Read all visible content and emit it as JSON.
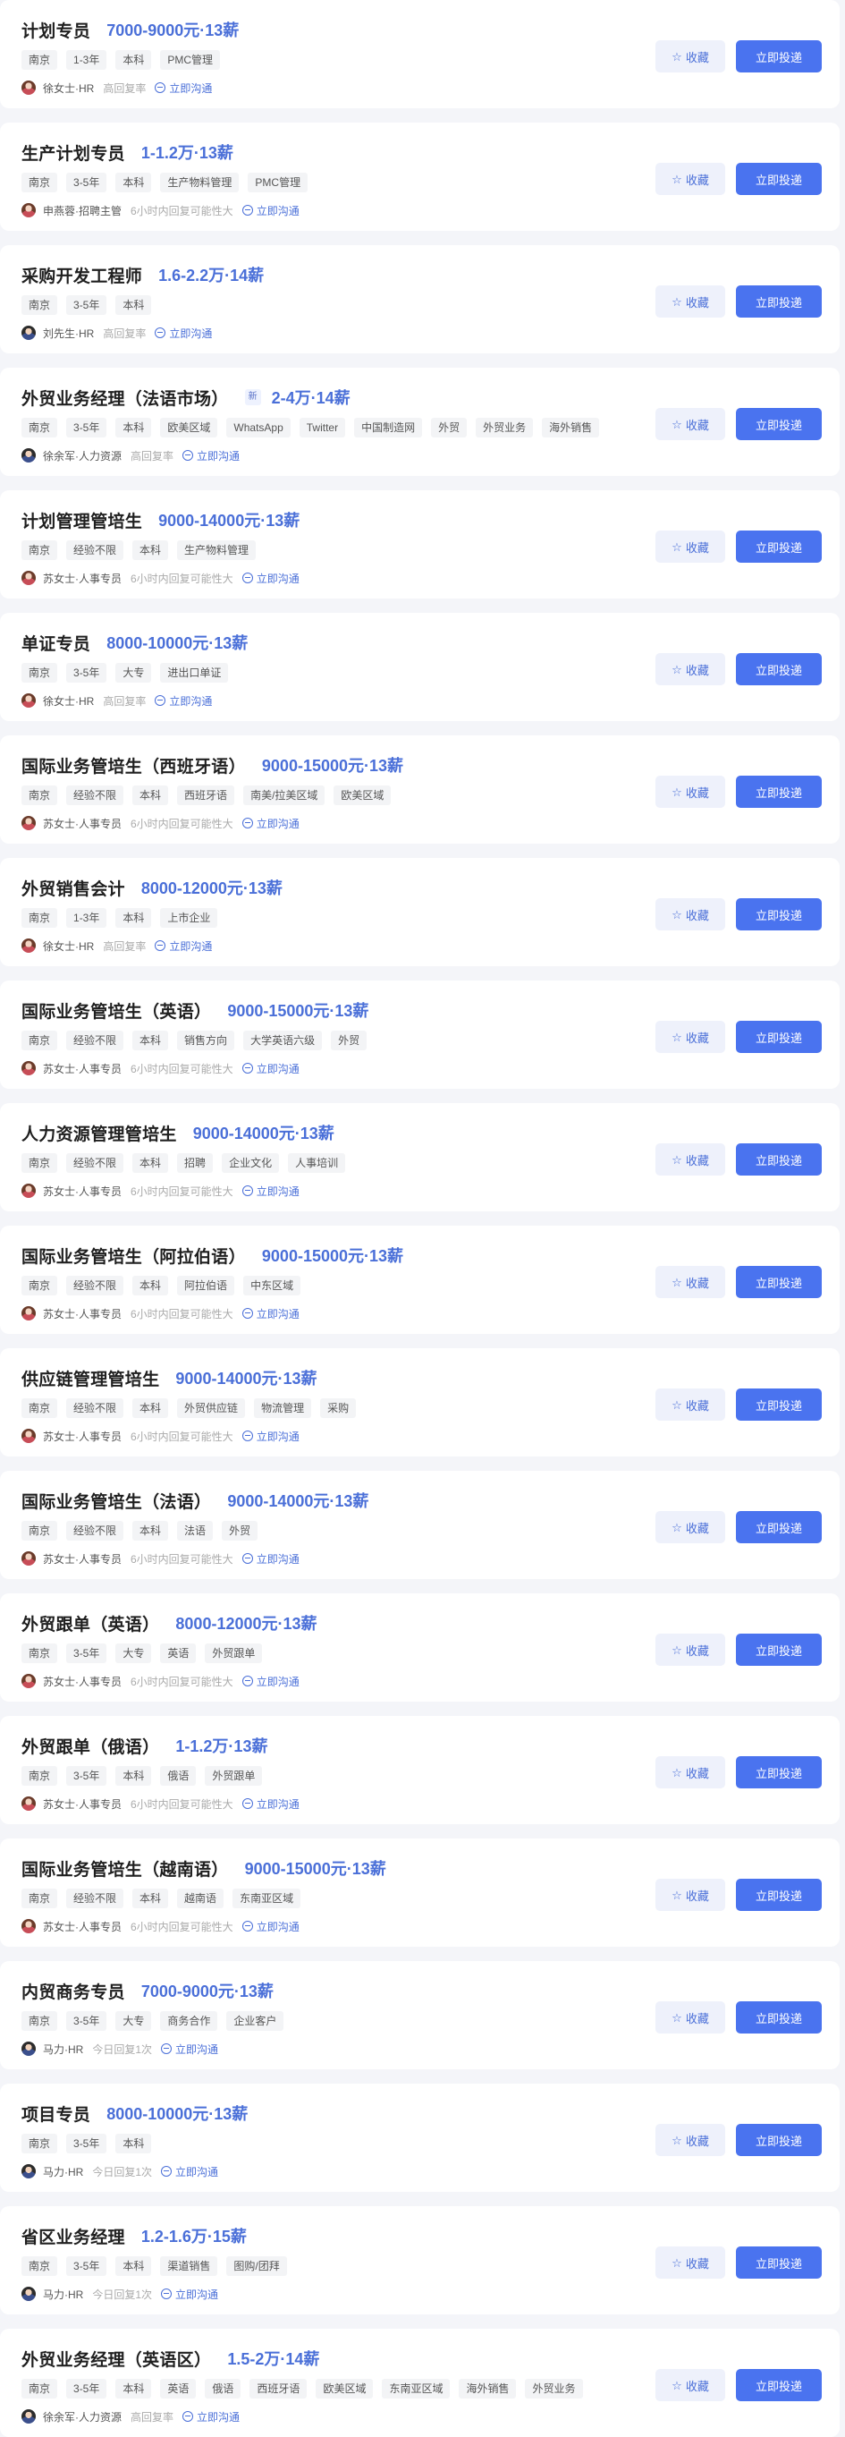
{
  "colors": {
    "accent": "#4a6fd8",
    "apply_button": "#4a73ef",
    "favorite_bg": "#eef1fb",
    "page_bg": "#f4f5f9"
  },
  "actions": {
    "favorite_label": "收藏",
    "apply_label": "立即投递",
    "chat_label": "立即沟通"
  },
  "jobs": [
    {
      "title": "计划专员",
      "badge": "",
      "salary": "7000-9000元·13薪",
      "tags": [
        "南京",
        "1-3年",
        "本科",
        "PMC管理"
      ],
      "recruiter": "徐女士·HR",
      "avatar": "female",
      "reply": "高回复率"
    },
    {
      "title": "生产计划专员",
      "badge": "",
      "salary": "1-1.2万·13薪",
      "tags": [
        "南京",
        "3-5年",
        "本科",
        "生产物料管理",
        "PMC管理"
      ],
      "recruiter": "申燕蓉·招聘主管",
      "avatar": "female",
      "reply": "6小时内回复可能性大"
    },
    {
      "title": "采购开发工程师",
      "badge": "",
      "salary": "1.6-2.2万·14薪",
      "tags": [
        "南京",
        "3-5年",
        "本科"
      ],
      "recruiter": "刘先生·HR",
      "avatar": "male",
      "reply": "高回复率"
    },
    {
      "title": "外贸业务经理（法语市场）",
      "badge": "新",
      "salary": "2-4万·14薪",
      "tags": [
        "南京",
        "3-5年",
        "本科",
        "欧美区域",
        "WhatsApp",
        "Twitter",
        "中国制造网",
        "外贸",
        "外贸业务",
        "海外销售"
      ],
      "recruiter": "徐余军·人力资源",
      "avatar": "male",
      "reply": "高回复率"
    },
    {
      "title": "计划管理管培生",
      "badge": "",
      "salary": "9000-14000元·13薪",
      "tags": [
        "南京",
        "经验不限",
        "本科",
        "生产物料管理"
      ],
      "recruiter": "苏女士·人事专员",
      "avatar": "female",
      "reply": "6小时内回复可能性大"
    },
    {
      "title": "单证专员",
      "badge": "",
      "salary": "8000-10000元·13薪",
      "tags": [
        "南京",
        "3-5年",
        "大专",
        "进出口单证"
      ],
      "recruiter": "徐女士·HR",
      "avatar": "female",
      "reply": "高回复率"
    },
    {
      "title": "国际业务管培生（西班牙语）",
      "badge": "",
      "salary": "9000-15000元·13薪",
      "tags": [
        "南京",
        "经验不限",
        "本科",
        "西班牙语",
        "南美/拉美区域",
        "欧美区域"
      ],
      "recruiter": "苏女士·人事专员",
      "avatar": "female",
      "reply": "6小时内回复可能性大"
    },
    {
      "title": "外贸销售会计",
      "badge": "",
      "salary": "8000-12000元·13薪",
      "tags": [
        "南京",
        "1-3年",
        "本科",
        "上市企业"
      ],
      "recruiter": "徐女士·HR",
      "avatar": "female",
      "reply": "高回复率"
    },
    {
      "title": "国际业务管培生（英语）",
      "badge": "",
      "salary": "9000-15000元·13薪",
      "tags": [
        "南京",
        "经验不限",
        "本科",
        "销售方向",
        "大学英语六级",
        "外贸"
      ],
      "recruiter": "苏女士·人事专员",
      "avatar": "female",
      "reply": "6小时内回复可能性大"
    },
    {
      "title": "人力资源管理管培生",
      "badge": "",
      "salary": "9000-14000元·13薪",
      "tags": [
        "南京",
        "经验不限",
        "本科",
        "招聘",
        "企业文化",
        "人事培训"
      ],
      "recruiter": "苏女士·人事专员",
      "avatar": "female",
      "reply": "6小时内回复可能性大"
    },
    {
      "title": "国际业务管培生（阿拉伯语）",
      "badge": "",
      "salary": "9000-15000元·13薪",
      "tags": [
        "南京",
        "经验不限",
        "本科",
        "阿拉伯语",
        "中东区域"
      ],
      "recruiter": "苏女士·人事专员",
      "avatar": "female",
      "reply": "6小时内回复可能性大"
    },
    {
      "title": "供应链管理管培生",
      "badge": "",
      "salary": "9000-14000元·13薪",
      "tags": [
        "南京",
        "经验不限",
        "本科",
        "外贸供应链",
        "物流管理",
        "采购"
      ],
      "recruiter": "苏女士·人事专员",
      "avatar": "female",
      "reply": "6小时内回复可能性大"
    },
    {
      "title": "国际业务管培生（法语）",
      "badge": "",
      "salary": "9000-14000元·13薪",
      "tags": [
        "南京",
        "经验不限",
        "本科",
        "法语",
        "外贸"
      ],
      "recruiter": "苏女士·人事专员",
      "avatar": "female",
      "reply": "6小时内回复可能性大"
    },
    {
      "title": "外贸跟单（英语）",
      "badge": "",
      "salary": "8000-12000元·13薪",
      "tags": [
        "南京",
        "3-5年",
        "大专",
        "英语",
        "外贸跟单"
      ],
      "recruiter": "苏女士·人事专员",
      "avatar": "female",
      "reply": "6小时内回复可能性大"
    },
    {
      "title": "外贸跟单（俄语）",
      "badge": "",
      "salary": "1-1.2万·13薪",
      "tags": [
        "南京",
        "3-5年",
        "本科",
        "俄语",
        "外贸跟单"
      ],
      "recruiter": "苏女士·人事专员",
      "avatar": "female",
      "reply": "6小时内回复可能性大"
    },
    {
      "title": "国际业务管培生（越南语）",
      "badge": "",
      "salary": "9000-15000元·13薪",
      "tags": [
        "南京",
        "经验不限",
        "本科",
        "越南语",
        "东南亚区域"
      ],
      "recruiter": "苏女士·人事专员",
      "avatar": "female",
      "reply": "6小时内回复可能性大"
    },
    {
      "title": "内贸商务专员",
      "badge": "",
      "salary": "7000-9000元·13薪",
      "tags": [
        "南京",
        "3-5年",
        "大专",
        "商务合作",
        "企业客户"
      ],
      "recruiter": "马力·HR",
      "avatar": "male",
      "reply": "今日回复1次"
    },
    {
      "title": "项目专员",
      "badge": "",
      "salary": "8000-10000元·13薪",
      "tags": [
        "南京",
        "3-5年",
        "本科"
      ],
      "recruiter": "马力·HR",
      "avatar": "male",
      "reply": "今日回复1次"
    },
    {
      "title": "省区业务经理",
      "badge": "",
      "salary": "1.2-1.6万·15薪",
      "tags": [
        "南京",
        "3-5年",
        "本科",
        "渠道销售",
        "图购/团拜"
      ],
      "recruiter": "马力·HR",
      "avatar": "male",
      "reply": "今日回复1次"
    },
    {
      "title": "外贸业务经理（英语区）",
      "badge": "",
      "salary": "1.5-2万·14薪",
      "tags": [
        "南京",
        "3-5年",
        "本科",
        "英语",
        "俄语",
        "西班牙语",
        "欧美区域",
        "东南亚区域",
        "海外销售",
        "外贸业务"
      ],
      "recruiter": "徐余军·人力资源",
      "avatar": "male",
      "reply": "高回复率"
    }
  ]
}
